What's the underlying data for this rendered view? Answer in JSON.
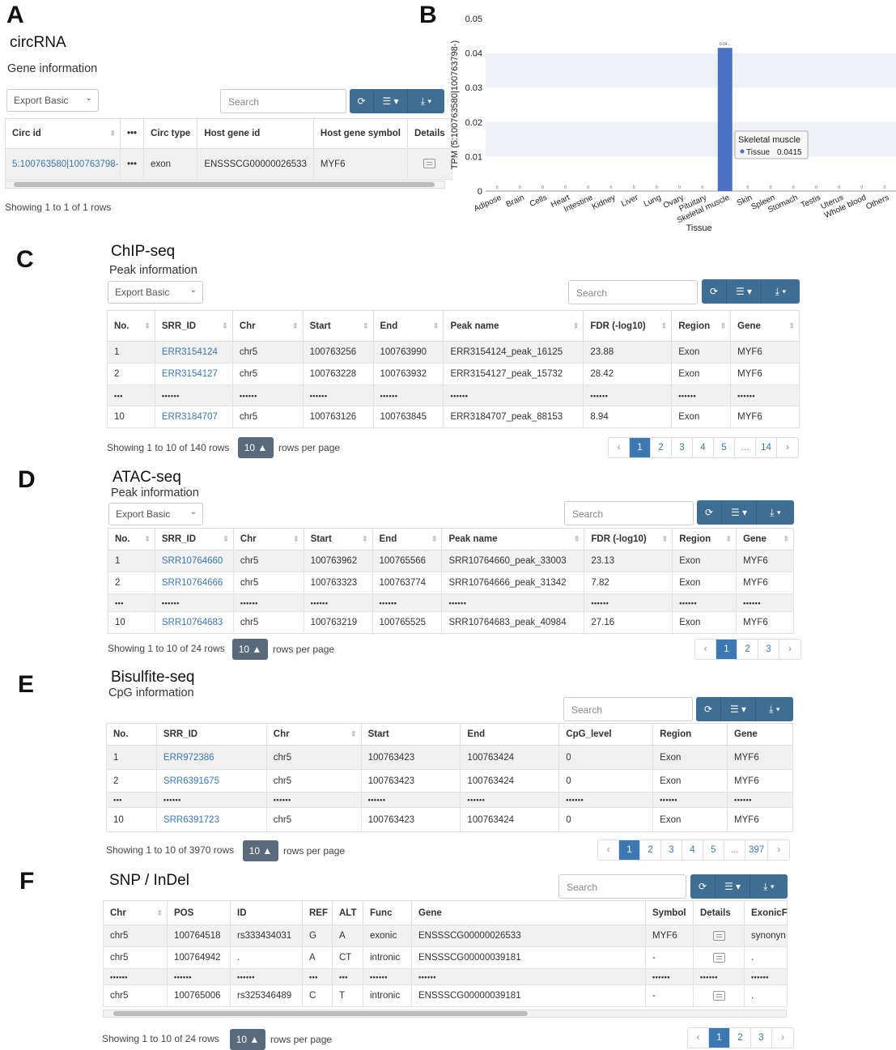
{
  "panels": {
    "a": "A",
    "b": "B",
    "c": "C",
    "d": "D",
    "e": "E",
    "f": "F"
  },
  "ui": {
    "export_label": "Export Basic",
    "search_placeholder": "Search",
    "rows_per_page_value": "10 ▲",
    "rows_per_page_text": "rows per page"
  },
  "circ": {
    "title": "circRNA",
    "subtitle": "Gene information",
    "headers": [
      "Circ id",
      "•••",
      "Circ type",
      "Host gene id",
      "Host gene symbol",
      "Details"
    ],
    "row": [
      "5:100763580|100763798-",
      "•••",
      "exon",
      "ENSSSCG00000026533",
      "MYF6"
    ],
    "info": "Showing 1 to 1 of 1 rows"
  },
  "chart_data": {
    "type": "bar",
    "xlabel": "Tissue",
    "ylabel": "TPM (5:100763580|100763798-)",
    "ylim": [
      0,
      0.05
    ],
    "yticks": [
      "0",
      "0.01",
      "0.02",
      "0.03",
      "0.04",
      "0.05"
    ],
    "categories": [
      "Adipose",
      "Brain",
      "Cells",
      "Heart",
      "Intestine",
      "Kidney",
      "Liver",
      "Lung",
      "Ovary",
      "Pituitary",
      "Skeletal muscle",
      "Skin",
      "Spleen",
      "Stomach",
      "Testis",
      "Uterus",
      "Whole blood",
      "Others"
    ],
    "values": [
      0,
      0,
      0,
      0,
      0,
      0,
      0,
      0,
      0,
      0,
      0.0415,
      0,
      0,
      0,
      0,
      0,
      0,
      0
    ],
    "zero_labels": "0",
    "peak_label": "0.04...",
    "tooltip": {
      "title": "Skeletal muscle",
      "series": "Tissue",
      "value": "0.0415"
    },
    "bar_color": "#4b72c4"
  },
  "chip": {
    "title": "ChIP-seq",
    "subtitle": "Peak information",
    "headers": [
      "No.",
      "SRR_ID",
      "Chr",
      "Start",
      "End",
      "Peak name",
      "FDR  (-log10)",
      "Region",
      "Gene"
    ],
    "rows": [
      [
        "1",
        "ERR3154124",
        "chr5",
        "100763256",
        "100763990",
        "ERR3154124_peak_16125",
        "23.88",
        "Exon",
        "MYF6"
      ],
      [
        "2",
        "ERR3154127",
        "chr5",
        "100763228",
        "100763932",
        "ERR3154127_peak_15732",
        "28.42",
        "Exon",
        "MYF6"
      ],
      [
        "•••",
        "••••••",
        "••••••",
        "••••••",
        "••••••",
        "••••••",
        "••••••",
        "••••••",
        "••••••"
      ],
      [
        "10",
        "ERR3184707",
        "chr5",
        "100763126",
        "100763845",
        "ERR3184707_peak_88153",
        "8.94",
        "Exon",
        "MYF6"
      ]
    ],
    "info": "Showing 1 to 10 of 140 rows",
    "pages": [
      "‹",
      "1",
      "2",
      "3",
      "4",
      "5",
      "...",
      "14",
      "›"
    ]
  },
  "atac": {
    "title": "ATAC-seq",
    "subtitle": "Peak information",
    "headers": [
      "No.",
      "SRR_ID",
      "Chr",
      "Start",
      "End",
      "Peak name",
      "FDR  (-log10)",
      "Region",
      "Gene"
    ],
    "rows": [
      [
        "1",
        "SRR10764660",
        "chr5",
        "100763962",
        "100765566",
        "SRR10764660_peak_33003",
        "23.13",
        "Exon",
        "MYF6"
      ],
      [
        "2",
        "SRR10764666",
        "chr5",
        "100763323",
        "100763774",
        "SRR10764666_peak_31342",
        "7.82",
        "Exon",
        "MYF6"
      ],
      [
        "•••",
        "••••••",
        "••••••",
        "••••••",
        "••••••",
        "••••••",
        "••••••",
        "••••••",
        "••••••"
      ],
      [
        "10",
        "SRR10764683",
        "chr5",
        "100763219",
        "100765525",
        "SRR10764683_peak_40984",
        "27.16",
        "Exon",
        "MYF6"
      ]
    ],
    "info": "Showing 1 to 10 of 24 rows",
    "pages": [
      "‹",
      "1",
      "2",
      "3",
      "›"
    ]
  },
  "bis": {
    "title": "Bisulfite-seq",
    "subtitle": "CpG information",
    "headers": [
      "No.",
      "SRR_ID",
      "Chr",
      "Start",
      "End",
      "CpG_level",
      "Region",
      "Gene"
    ],
    "rows": [
      [
        "1",
        "ERR972386",
        "chr5",
        "100763423",
        "100763424",
        "0",
        "Exon",
        "MYF6"
      ],
      [
        "2",
        "SRR6391675",
        "chr5",
        "100763423",
        "100763424",
        "0",
        "Exon",
        "MYF6"
      ],
      [
        "•••",
        "••••••",
        "••••••",
        "••••••",
        "••••••",
        "••••••",
        "••••••",
        "••••••"
      ],
      [
        "10",
        "SRR6391723",
        "chr5",
        "100763423",
        "100763424",
        "0",
        "Exon",
        "MYF6"
      ]
    ],
    "info": "Showing 1 to 10 of 3970 rows",
    "pages": [
      "‹",
      "1",
      "2",
      "3",
      "4",
      "5",
      "...",
      "397",
      "›"
    ]
  },
  "snp": {
    "title": "SNP / InDel",
    "headers": [
      "Chr",
      "POS",
      "ID",
      "REF",
      "ALT",
      "Func",
      "Gene",
      "Symbol",
      "Details",
      "ExonicF"
    ],
    "rows": [
      [
        "chr5",
        "100764518",
        "rs333434031",
        "G",
        "A",
        "exonic",
        "ENSSSCG00000026533",
        "MYF6",
        "",
        "synonyn"
      ],
      [
        "chr5",
        "100764942",
        ".",
        "A",
        "CT",
        "intronic",
        "ENSSSCG00000039181",
        "-",
        "",
        "."
      ],
      [
        "••••••",
        "••••••",
        "••••••",
        "•••",
        "•••",
        "••••••",
        "••••••",
        "••••••",
        "••••••",
        "••••••"
      ],
      [
        "chr5",
        "100765006",
        "rs325346489",
        "C",
        "T",
        "intronic",
        "ENSSSCG00000039181",
        "-",
        "",
        "."
      ]
    ],
    "info": "Showing 1 to 10 of 24 rows",
    "pages": [
      "‹",
      "1",
      "2",
      "3",
      "›"
    ]
  }
}
